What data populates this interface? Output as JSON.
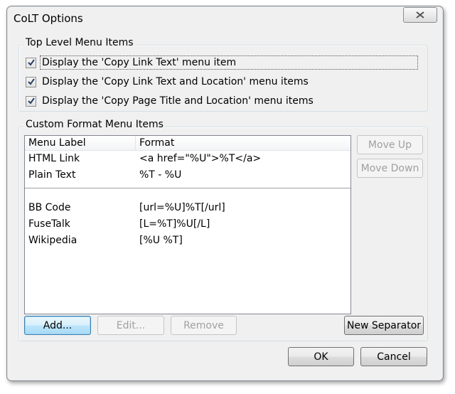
{
  "window": {
    "title": "CoLT Options"
  },
  "top_level": {
    "label": "Top Level Menu Items",
    "items": [
      {
        "label": "Display the 'Copy Link Text' menu item",
        "checked": true
      },
      {
        "label": "Display the 'Copy Link Text and Location' menu items",
        "checked": true
      },
      {
        "label": "Display the 'Copy Page Title and Location' menu items",
        "checked": true
      }
    ]
  },
  "custom": {
    "label": "Custom Format Menu Items",
    "columns": [
      "Menu Label",
      "Format"
    ],
    "rows": [
      {
        "label": "HTML Link",
        "format": "<a href=\"%U\">%T</a>"
      },
      {
        "label": "Plain Text",
        "format": "%T - %U"
      },
      {
        "separator": true
      },
      {
        "label": "BB Code",
        "format": "[url=%U]%T[/url]"
      },
      {
        "label": "FuseTalk",
        "format": "[L=%T]%U[/L]"
      },
      {
        "label": "Wikipedia",
        "format": "[%U %T]"
      }
    ]
  },
  "buttons": {
    "move_up": "Move Up",
    "move_down": "Move Down",
    "add": "Add...",
    "edit": "Edit...",
    "remove": "Remove",
    "new_separator": "New Separator",
    "ok": "OK",
    "cancel": "Cancel"
  },
  "icons": {
    "close": "close-icon",
    "check": "checkmark-icon"
  }
}
